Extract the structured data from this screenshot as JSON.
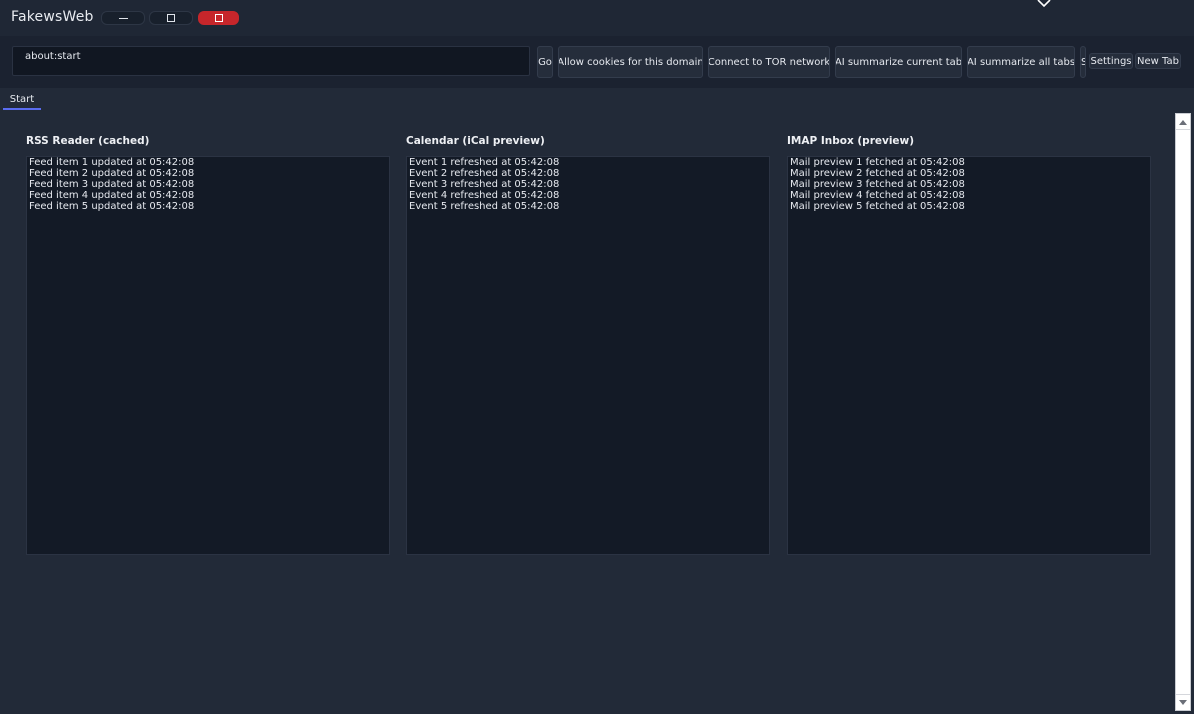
{
  "app": {
    "title": "FakewsWeb"
  },
  "toolbar": {
    "url_value": "about:start",
    "go_label": "Go",
    "cookies_label": "Allow cookies for this domain",
    "tor_label": "Connect to TOR network",
    "ai_current_label": "AI summarize current tab",
    "ai_all_label": "AI summarize all tabs",
    "overflow_label": "S",
    "settings_label": "Settings",
    "new_tab_label": "New Tab"
  },
  "tabs": [
    {
      "label": "Start",
      "active": true
    }
  ],
  "panels": [
    {
      "title": "RSS Reader (cached)",
      "lines": [
        "Feed item 1 updated at 05:42:08",
        "Feed item 2 updated at 05:42:08",
        "Feed item 3 updated at 05:42:08",
        "Feed item 4 updated at 05:42:08",
        "Feed item 5 updated at 05:42:08"
      ]
    },
    {
      "title": "Calendar (iCal preview)",
      "lines": [
        "Event 1 refreshed at 05:42:08",
        "Event 2 refreshed at 05:42:08",
        "Event 3 refreshed at 05:42:08",
        "Event 4 refreshed at 05:42:08",
        "Event 5 refreshed at 05:42:08"
      ]
    },
    {
      "title": "IMAP Inbox (preview)",
      "lines": [
        "Mail preview 1 fetched at 05:42:08",
        "Mail preview 2 fetched at 05:42:08",
        "Mail preview 3 fetched at 05:42:08",
        "Mail preview 4 fetched at 05:42:08",
        "Mail preview 5 fetched at 05:42:08"
      ]
    }
  ],
  "colors": {
    "background": "#222a38",
    "close_button": "#c6262b",
    "tab_accent": "#5a6cf0"
  },
  "icons": [
    "minimize-icon",
    "maximize-icon",
    "close-icon",
    "cursor-icon",
    "scroll-up-icon",
    "scroll-down-icon"
  ]
}
